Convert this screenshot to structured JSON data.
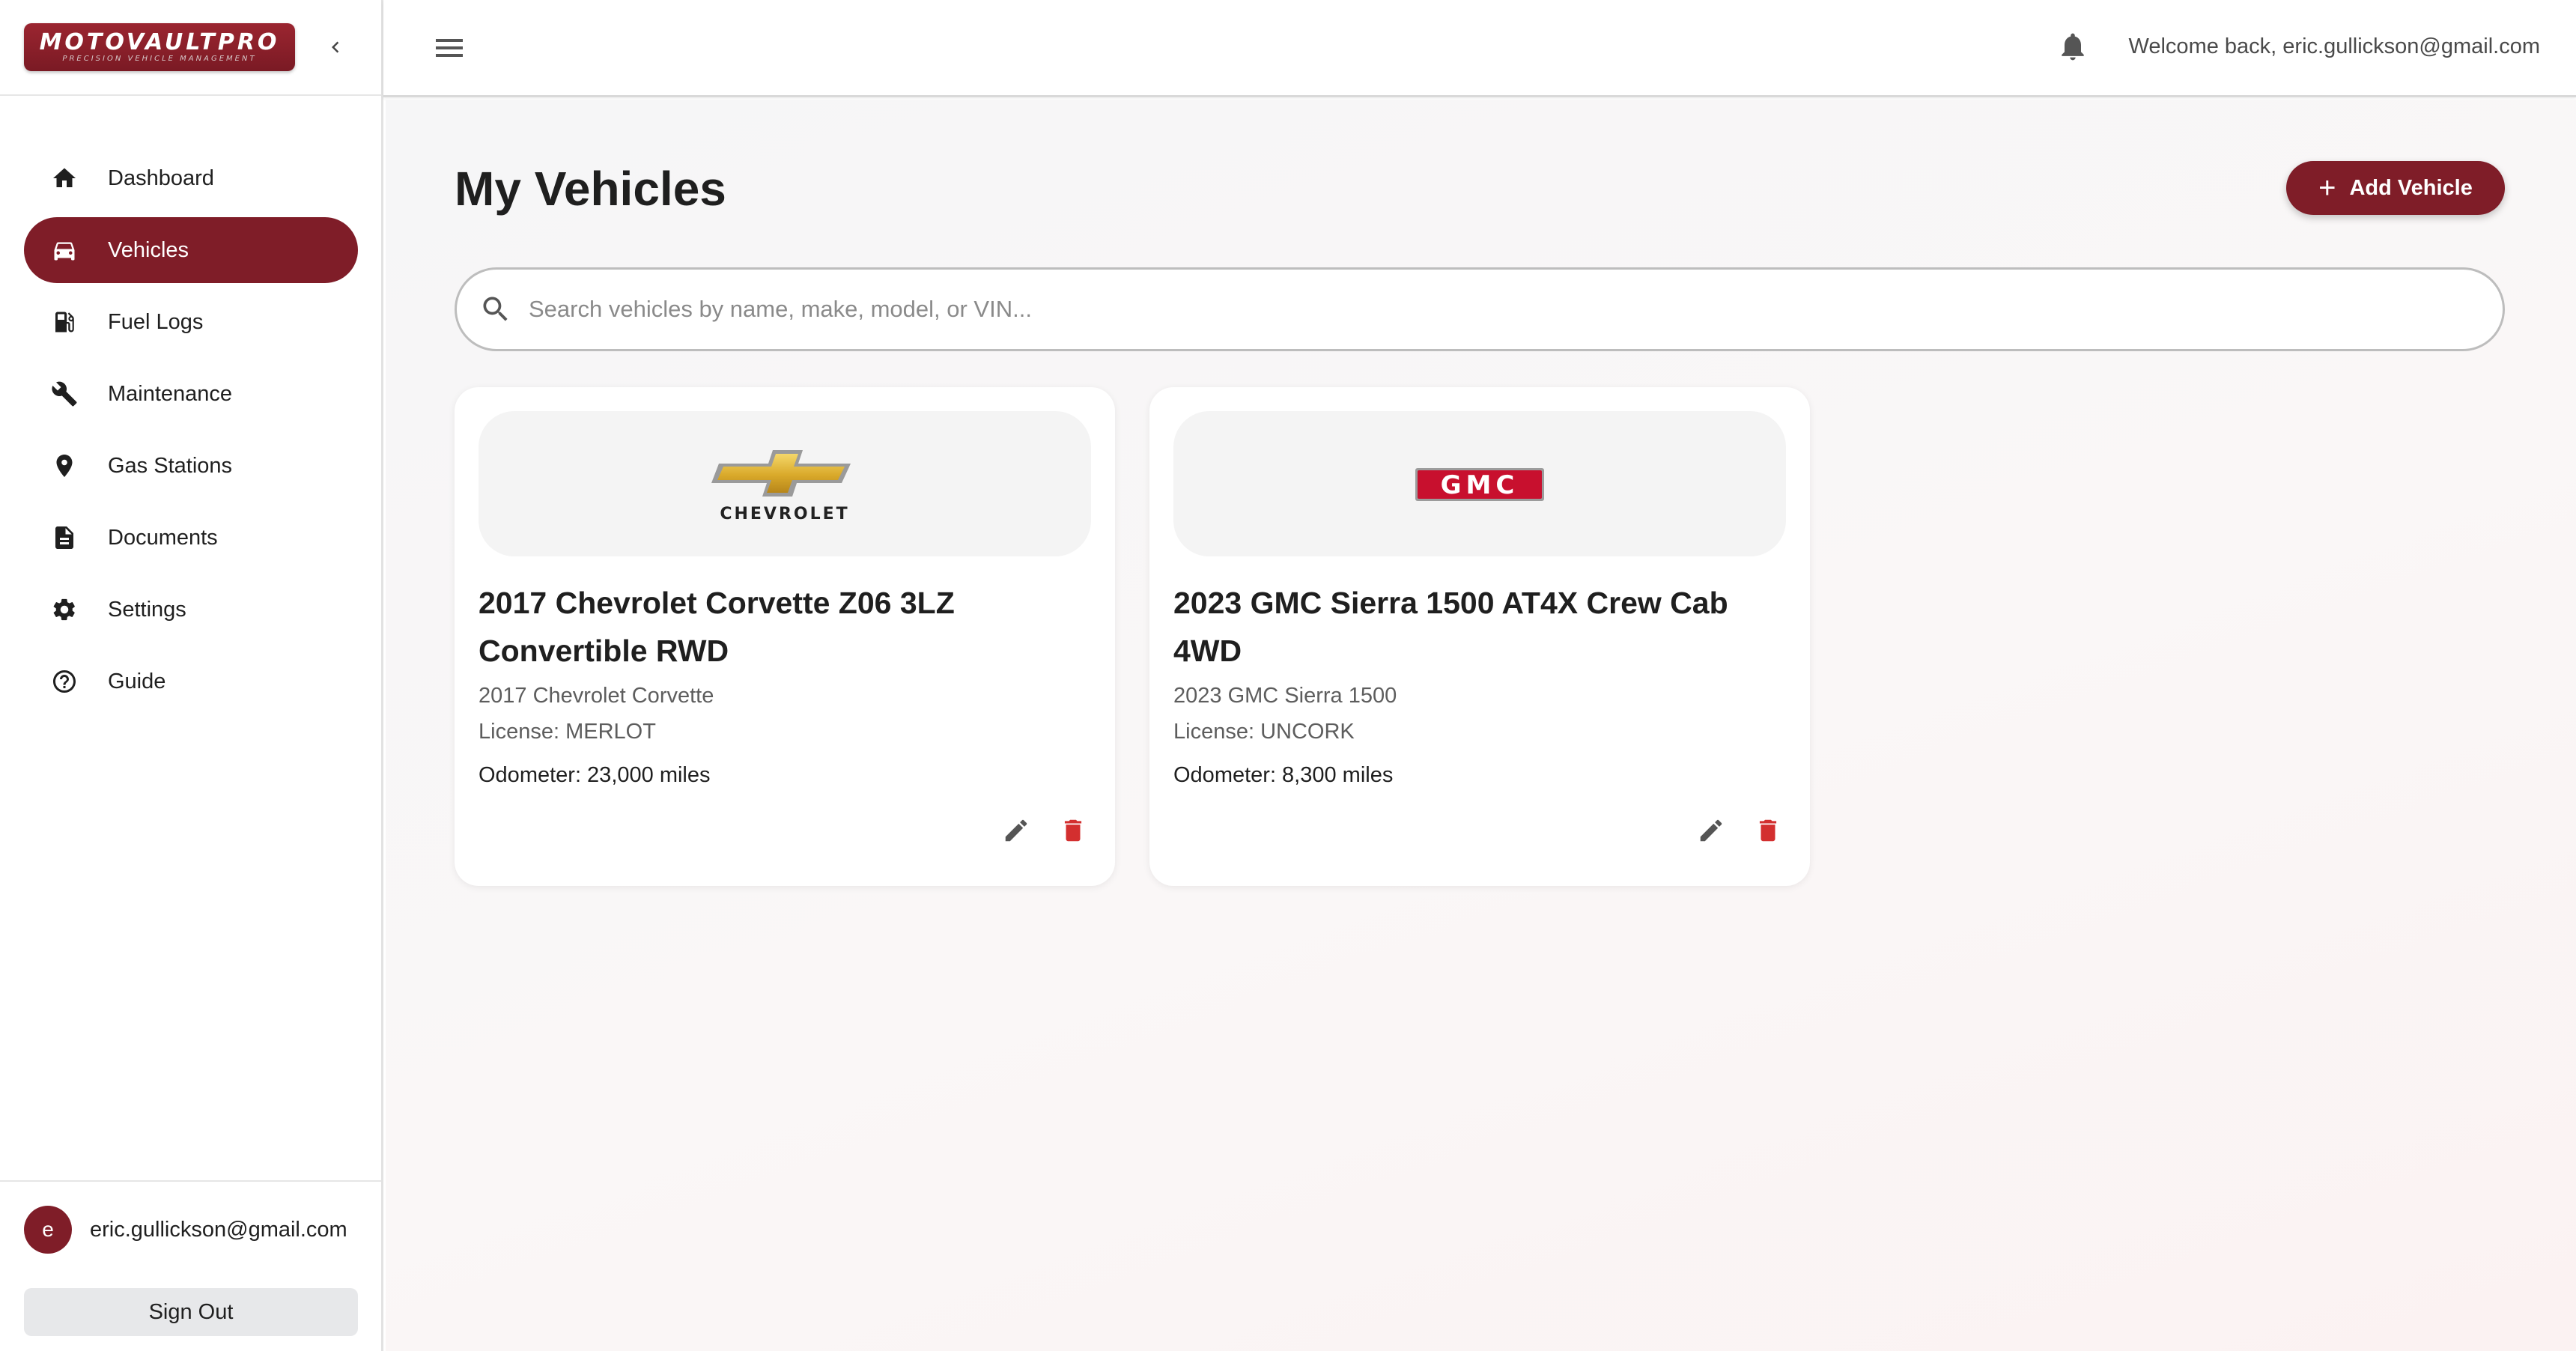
{
  "brand": {
    "name": "MOTOVAULTPRO",
    "tagline": "PRECISION VEHICLE MANAGEMENT"
  },
  "sidebar": {
    "items": [
      {
        "label": "Dashboard",
        "icon": "home-icon",
        "active": false
      },
      {
        "label": "Vehicles",
        "icon": "car-icon",
        "active": true
      },
      {
        "label": "Fuel Logs",
        "icon": "fuel-pump-icon",
        "active": false
      },
      {
        "label": "Maintenance",
        "icon": "wrench-icon",
        "active": false
      },
      {
        "label": "Gas Stations",
        "icon": "location-pin-icon",
        "active": false
      },
      {
        "label": "Documents",
        "icon": "document-icon",
        "active": false
      },
      {
        "label": "Settings",
        "icon": "gear-icon",
        "active": false
      },
      {
        "label": "Guide",
        "icon": "help-circle-icon",
        "active": false
      }
    ],
    "user": {
      "avatar_initial": "e",
      "email": "eric.gullickson@gmail.com"
    },
    "sign_out_label": "Sign Out"
  },
  "header": {
    "welcome": "Welcome back, eric.gullickson@gmail.com"
  },
  "main": {
    "title": "My Vehicles",
    "add_label": "Add Vehicle",
    "search_placeholder": "Search vehicles by name, make, model, or VIN...",
    "vehicles": [
      {
        "brand_logo": "CHEVROLET",
        "title": "2017 Chevrolet Corvette Z06 3LZ Convertible RWD",
        "subtitle": "2017 Chevrolet Corvette",
        "license": "License: MERLOT",
        "odometer": "Odometer: 23,000 miles"
      },
      {
        "brand_logo": "GMC",
        "title": "2023 GMC Sierra 1500 AT4X Crew Cab 4WD",
        "subtitle": "2023 GMC Sierra 1500",
        "license": "License: UNCORK",
        "odometer": "Odometer: 8,300 miles"
      }
    ]
  },
  "colors": {
    "accent": "#7f1d28",
    "delete": "#d32f2f",
    "edit": "#555555"
  }
}
